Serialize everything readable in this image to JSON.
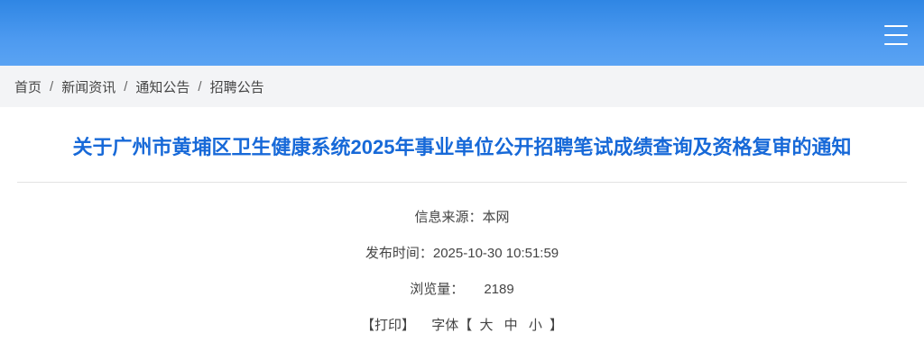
{
  "header": {
    "menu_icon": "hamburger-menu-icon",
    "gradient_top": "#2f86e4",
    "gradient_bottom": "#5aa3f3"
  },
  "breadcrumb": {
    "items": [
      "首页",
      "新闻资讯",
      "通知公告",
      "招聘公告"
    ],
    "separator": "/"
  },
  "article": {
    "title": "关于广州市黄埔区卫生健康系统2025年事业单位公开招聘笔试成绩查询及资格复审的通知",
    "title_color": "#1769d8",
    "source_label": "信息来源：",
    "source_value": "本网",
    "publish_label": "发布时间：",
    "publish_value": "2025-10-30 10:51:59",
    "views_label": "浏览量：",
    "views_value": "2189",
    "print_label": "【打印】",
    "font_label": "字体【",
    "font_large": "大",
    "font_medium": "中",
    "font_small": "小",
    "font_close": "】"
  }
}
